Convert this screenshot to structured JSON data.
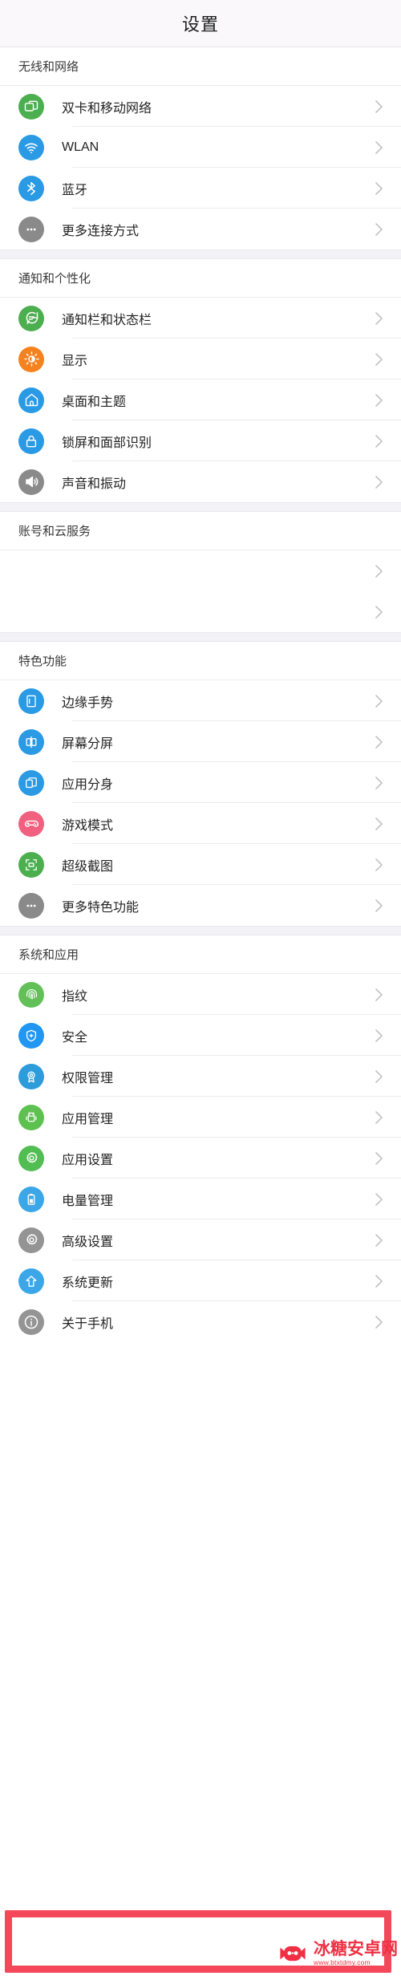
{
  "header": {
    "title": "设置"
  },
  "sections": [
    {
      "id": "wireless",
      "header": "无线和网络",
      "items": [
        {
          "label": "双卡和移动网络",
          "icon": "sim-card-icon",
          "color": "#4caf4f"
        },
        {
          "label": "WLAN",
          "icon": "wifi-icon",
          "color": "#2a9ae5"
        },
        {
          "label": "蓝牙",
          "icon": "bluetooth-icon",
          "color": "#2a9ae5"
        },
        {
          "label": "更多连接方式",
          "icon": "ellipsis-icon",
          "color": "#8a8a8a"
        }
      ]
    },
    {
      "id": "notification",
      "header": "通知和个性化",
      "items": [
        {
          "label": "通知栏和状态栏",
          "icon": "chat-bubble-icon",
          "color": "#4caf4f"
        },
        {
          "label": "显示",
          "icon": "brightness-icon",
          "color": "#f5821f"
        },
        {
          "label": "桌面和主题",
          "icon": "home-icon",
          "color": "#2a9ae5"
        },
        {
          "label": "锁屏和面部识别",
          "icon": "lock-icon",
          "color": "#2a9ae5"
        },
        {
          "label": "声音和振动",
          "icon": "speaker-icon",
          "color": "#8a8a8a"
        }
      ]
    },
    {
      "id": "account",
      "header": "账号和云服务",
      "redacted": true,
      "items": [
        {
          "label": "",
          "icon": "redacted-icon",
          "color": "#f2445b"
        },
        {
          "label": "",
          "icon": "redacted-icon",
          "color": "#f5222d"
        }
      ]
    },
    {
      "id": "features",
      "header": "特色功能",
      "items": [
        {
          "label": "边缘手势",
          "icon": "edge-gesture-icon",
          "color": "#2a9ae5"
        },
        {
          "label": "屏幕分屏",
          "icon": "split-screen-icon",
          "color": "#2a9ae5"
        },
        {
          "label": "应用分身",
          "icon": "app-clone-icon",
          "color": "#2a9ae5"
        },
        {
          "label": "游戏模式",
          "icon": "gamepad-icon",
          "color": "#f1607e"
        },
        {
          "label": "超级截图",
          "icon": "screenshot-icon",
          "color": "#4caf4f"
        },
        {
          "label": "更多特色功能",
          "icon": "ellipsis-icon",
          "color": "#8a8a8a"
        }
      ]
    },
    {
      "id": "system",
      "header": "系统和应用",
      "items": [
        {
          "label": "指纹",
          "icon": "fingerprint-icon",
          "color": "#4caf4f"
        },
        {
          "label": "安全",
          "icon": "shield-icon",
          "color": "#2a9ae5"
        },
        {
          "label": "权限管理",
          "icon": "badge-icon",
          "color": "#2a9ae5"
        },
        {
          "label": "应用管理",
          "icon": "android-icon",
          "color": "#4caf4f"
        },
        {
          "label": "应用设置",
          "icon": "gear-icon",
          "color": "#4caf4f"
        },
        {
          "label": "电量管理",
          "icon": "battery-icon",
          "color": "#2a9ae5"
        },
        {
          "label": "高级设置",
          "icon": "gear-icon",
          "color": "#8a8a8a"
        },
        {
          "label": "系统更新",
          "icon": "arrow-up-icon",
          "color": "#2a9ae5"
        },
        {
          "label": "关于手机",
          "icon": "info-icon",
          "color": "#8a8a8a",
          "highlighted": true
        }
      ]
    }
  ],
  "annotation": {
    "highlight_color": "#f4485a",
    "highlight_target": "关于手机"
  },
  "watermark": {
    "name": "冰糖安卓网",
    "url": "www.btxtdmy.com",
    "color": "#ef3043"
  }
}
